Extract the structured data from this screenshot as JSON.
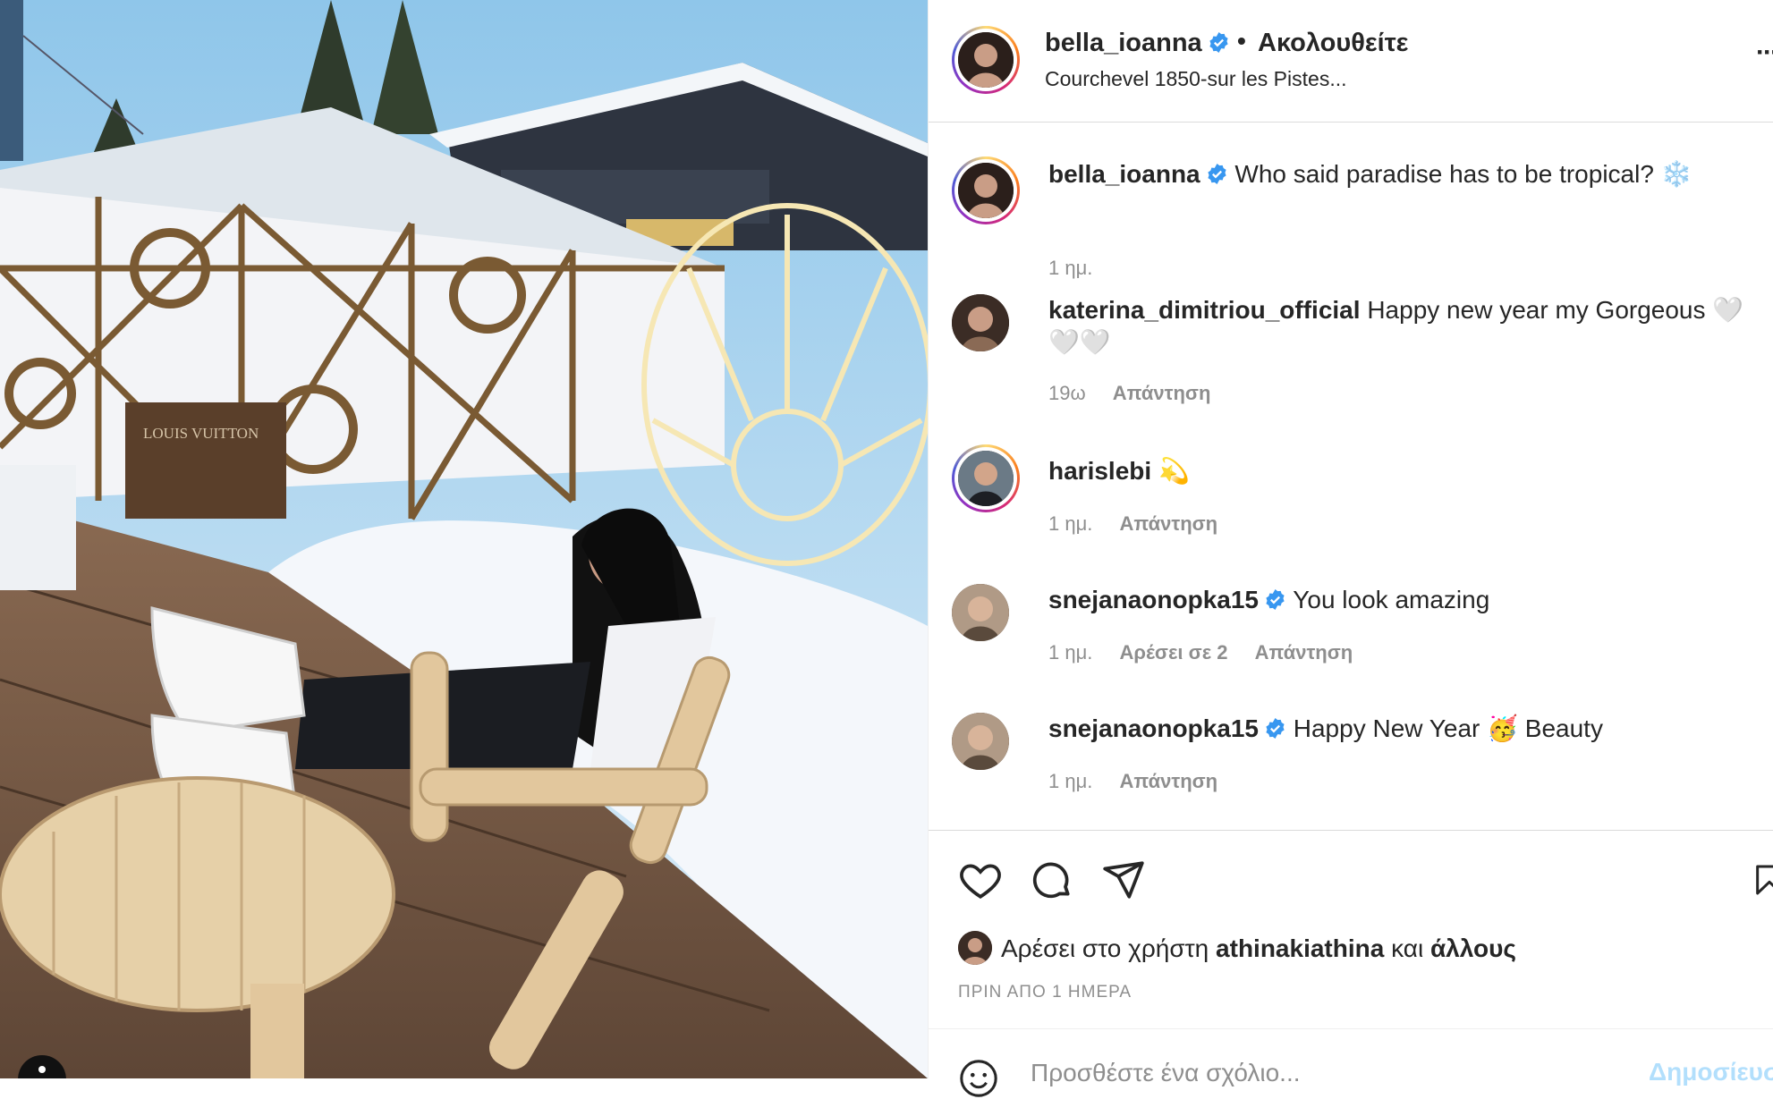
{
  "post": {
    "username": "bella_ioanna",
    "separator": "•",
    "follow_state": "Ακολουθείτε",
    "location": "Courchevel 1850-sur les Pistes...",
    "more": "···"
  },
  "comments": [
    {
      "username": "bella_ioanna",
      "verified": true,
      "text": "Who said paradise has to be tropical? ❄️",
      "time": "1 ημ.",
      "likes": "",
      "reply": "",
      "story_ring": true
    },
    {
      "username": "katerina_dimitriou_official",
      "verified": false,
      "text": "Happy new year my Gorgeous 🤍🤍🤍",
      "time": "19ω",
      "likes": "",
      "reply": "Απάντηση",
      "story_ring": false
    },
    {
      "username": "harislebi",
      "verified": false,
      "text": "💫",
      "time": "1 ημ.",
      "likes": "",
      "reply": "Απάντηση",
      "story_ring": true
    },
    {
      "username": "snejanaonopka15",
      "verified": true,
      "text": "You look amazing",
      "time": "1 ημ.",
      "likes": "Αρέσει σε 2",
      "reply": "Απάντηση",
      "story_ring": false
    },
    {
      "username": "snejanaonopka15",
      "verified": true,
      "text": "Happy New Year 🥳 Beauty",
      "time": "1 ημ.",
      "likes": "",
      "reply": "Απάντηση",
      "story_ring": false
    }
  ],
  "likes": {
    "prefix": "Αρέσει στο χρήστη",
    "user": "athinakiathina",
    "conj": "και",
    "others": "άλλους"
  },
  "posted_ago": "ΠΡΙΝ ΑΠΟ 1 ΗΜΕΡΑ",
  "add_comment": {
    "placeholder": "Προσθέστε ένα σχόλιο...",
    "post_label": "Δημοσίευση"
  },
  "photo_sign": "LOUIS VUITTON",
  "colors": {
    "verified": "#3897f0",
    "muted": "#8e8e8e",
    "post_button": "#b2dffc",
    "text": "#262626"
  },
  "icons": [
    "heart-icon",
    "comment-icon",
    "share-icon",
    "bookmark-icon",
    "emoji-icon",
    "verified-icon",
    "more-icon"
  ]
}
